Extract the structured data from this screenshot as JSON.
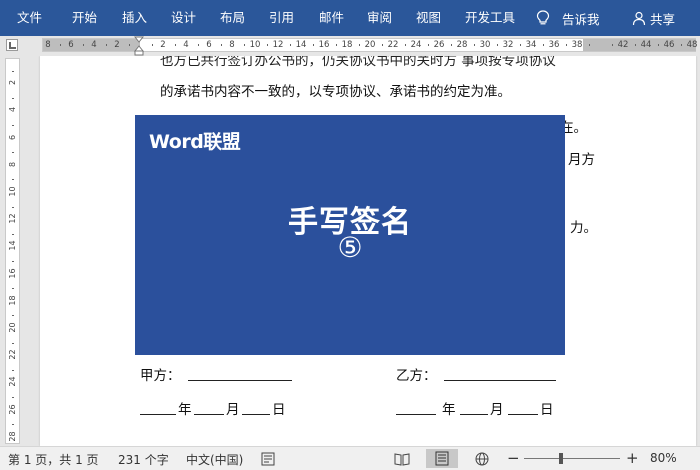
{
  "ribbon": {
    "tabs": [
      "文件",
      "开始",
      "插入",
      "设计",
      "布局",
      "引用",
      "邮件",
      "审阅",
      "视图",
      "开发工具"
    ],
    "tell_me": "告诉我",
    "share": "共享",
    "color": "#2b579a"
  },
  "ruler": {
    "left_numbers": [
      "8",
      "6",
      "4",
      "2"
    ],
    "right_numbers": [
      "2",
      "4",
      "6",
      "8",
      "10",
      "12",
      "14",
      "16",
      "18",
      "20",
      "22",
      "24",
      "26",
      "28",
      "30",
      "32",
      "34",
      "36",
      "38",
      "42",
      "44",
      "46",
      "48"
    ],
    "vertical_numbers": [
      "2",
      "4",
      "6",
      "8",
      "10",
      "12",
      "14",
      "16",
      "18",
      "20",
      "22",
      "24",
      "26",
      "28"
    ]
  },
  "document": {
    "line_cut_top": "也方已共行签订办公书的，仍关协议书中的关时方 事项按专项协议",
    "line1": "的承诺书内容不一致的，以专项协议、承诺书的约定为准。",
    "right_fragment1": "在。",
    "right_fragment2": "月方",
    "right_fragment3": "力。",
    "party_a": "甲方：",
    "party_b": "乙方：",
    "date_a": [
      "年",
      "月",
      "日"
    ],
    "date_b": [
      "年",
      "月",
      "日"
    ]
  },
  "overlay": {
    "brand": "Word联盟",
    "title": "手写签名",
    "number": "⑤",
    "color": "#2b509c"
  },
  "status": {
    "page": "第 1 页，共 1 页",
    "words": "231 个字",
    "language": "中文(中国)",
    "zoom": "80%",
    "zoom_minus": "−",
    "zoom_plus": "+"
  }
}
